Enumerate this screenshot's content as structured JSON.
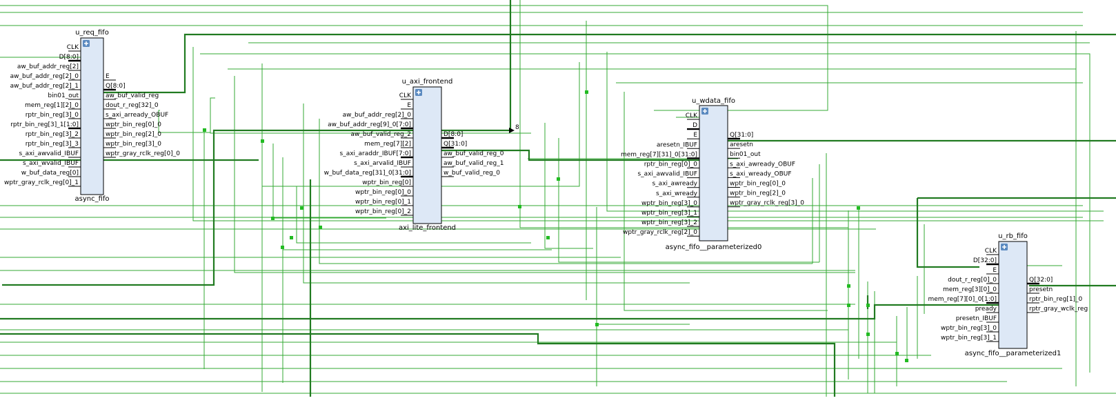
{
  "colors": {
    "wire": "#33aa33",
    "bus": "#207a20",
    "block_fill": "#dde8f6",
    "junction": "#22bb22"
  },
  "icons": [
    "expand-plus-icon",
    "arrow-right-icon"
  ],
  "cells": [
    {
      "id": "u_req_fifo",
      "instance": "u_req_fifo",
      "type": "async_fifo",
      "inputs": [
        "CLK",
        "D[8:0]",
        "aw_buf_addr_reg[2]",
        "aw_buf_addr_reg[2]_0",
        "aw_buf_addr_reg[2]_1",
        "bin01_out",
        "mem_reg[1][2]_0",
        "rptr_bin_reg[3]_0",
        "rptr_bin_reg[3]_1[1:0]",
        "rptr_bin_reg[3]_2",
        "rptr_bin_reg[3]_3",
        "s_axi_awvalid_IBUF",
        "s_axi_wvalid_IBUF",
        "w_buf_data_reg[0]",
        "wptr_gray_rclk_reg[0]_1"
      ],
      "outputs": [
        "E",
        "Q[8:0]",
        "aw_buf_valid_reg",
        "dout_r_reg[32]_0",
        "s_axi_arready_OBUF",
        "wptr_bin_reg[0]_0",
        "wptr_bin_reg[2]_0",
        "wptr_bin_reg[3]_0",
        "wptr_gray_rclk_reg[0]_0"
      ]
    },
    {
      "id": "u_axi_frontend",
      "instance": "u_axi_frontend",
      "type": "axi_lite_frontend",
      "inputs": [
        "CLK",
        "E",
        "aw_buf_addr_reg[2]_0",
        "aw_buf_addr_reg[9]_0[7:0]",
        "aw_buf_valid_reg_2",
        "mem_reg[7][2]",
        "s_axi_araddr_IBUF[7:0]",
        "s_axi_arvalid_IBUF",
        "w_buf_data_reg[31]_0[31:0]",
        "wptr_bin_reg[0]",
        "wptr_bin_reg[0]_0",
        "wptr_bin_reg[0]_1",
        "wptr_bin_reg[0]_2"
      ],
      "outputs": [
        "D[8:0]",
        "Q[31:0]",
        "aw_buf_valid_reg_0",
        "aw_buf_valid_reg_1",
        "w_buf_valid_reg_0"
      ]
    },
    {
      "id": "u_wdata_fifo",
      "instance": "u_wdata_fifo",
      "type": "async_fifo__parameterized0",
      "inputs": [
        "CLK",
        "D",
        "E",
        "aresetn_IBUF",
        "mem_reg[7][31]_0[31:0]",
        "rptr_bin_reg[0]_0",
        "s_axi_awvalid_IBUF",
        "s_axi_awready",
        "s_axi_wready",
        "wptr_bin_reg[3]_0",
        "wptr_bin_reg[3]_1",
        "wptr_bin_reg[3]_2",
        "wptr_gray_rclk_reg[2]_0"
      ],
      "outputs": [
        "Q[31:0]",
        "aresetn",
        "bin01_out",
        "s_axi_awready_OBUF",
        "s_axi_wready_OBUF",
        "wptr_bin_reg[0]_0",
        "wptr_bin_reg[2]_0",
        "wptr_gray_rclk_reg[3]_0"
      ]
    },
    {
      "id": "u_rb_fifo",
      "instance": "u_rb_fifo",
      "type": "async_fifo__parameterized1",
      "inputs": [
        "CLK",
        "D[32:0]",
        "E",
        "dout_r_reg[0]_0",
        "mem_reg[3][0]_0",
        "mem_reg[7][0]_0[1:0]",
        "pready",
        "presetn_IBUF",
        "wptr_bin_reg[3]_0",
        "wptr_bin_reg[3]_1"
      ],
      "outputs": [
        "Q[32:0]",
        "presetn",
        "rptr_bin_reg[1]_0",
        "rptr_gray_wclk_reg"
      ]
    }
  ],
  "bus_width_label": "8"
}
